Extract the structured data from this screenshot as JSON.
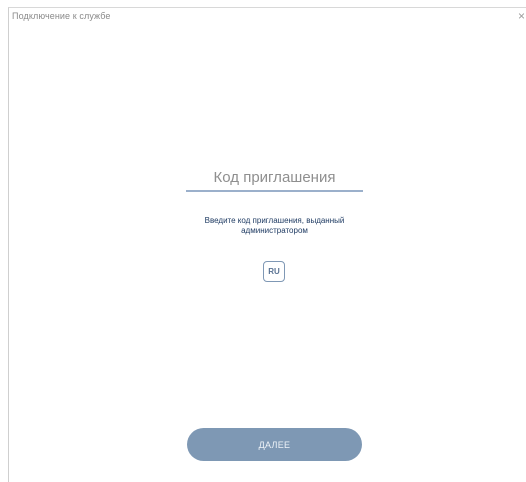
{
  "window": {
    "title": "Подключение к службе",
    "close_symbol": "×"
  },
  "form": {
    "code_placeholder": "Код приглашения",
    "code_value": "",
    "hint": "Введите код приглашения, выданный администратором",
    "language_label": "RU",
    "next_label": "ДАЛЕЕ"
  },
  "icons": {
    "close": "close-icon"
  },
  "colors": {
    "accent": "#7e98b4",
    "underline": "#9bb0cb",
    "hint_text": "#1f3b63"
  }
}
